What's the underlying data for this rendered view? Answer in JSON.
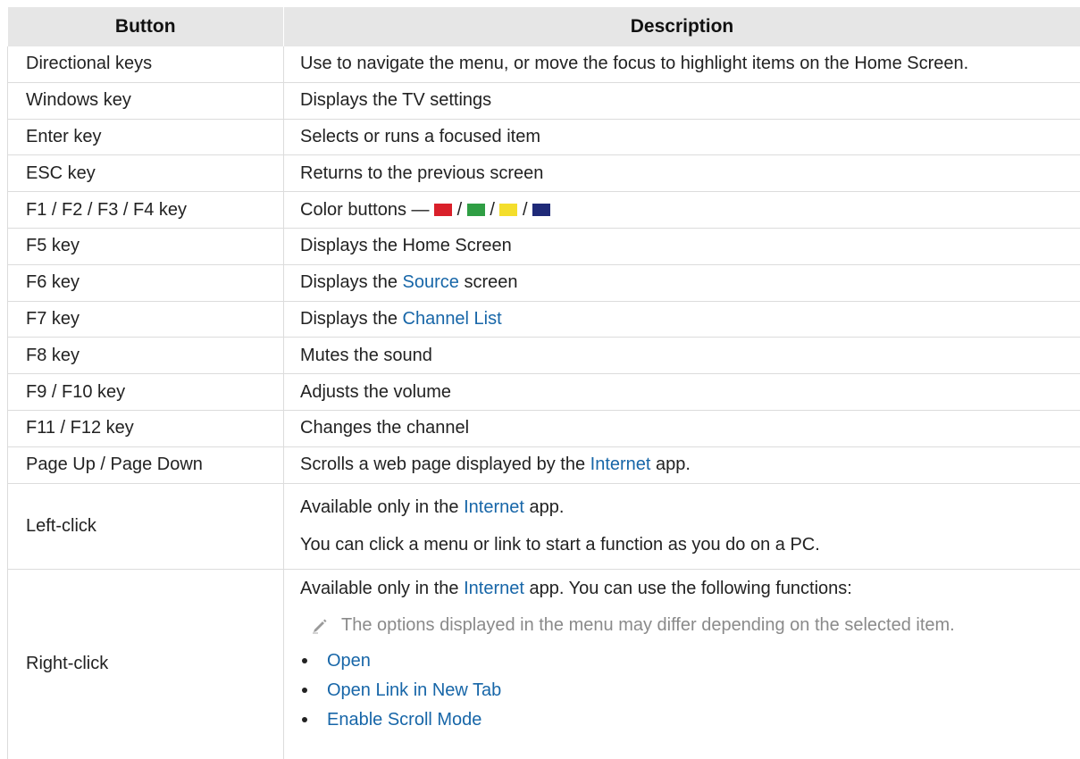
{
  "table": {
    "headers": [
      "Button",
      "Description"
    ],
    "rows": [
      {
        "button": "Directional keys",
        "description": "Use to navigate the menu, or move the focus to highlight items on the Home Screen."
      },
      {
        "button": "Windows key",
        "description": "Displays the TV settings"
      },
      {
        "button": "Enter key",
        "description": "Selects or runs a focused item"
      },
      {
        "button": "ESC key",
        "description": "Returns to the previous screen"
      },
      {
        "button": "F1 / F2 / F3 / F4 key",
        "description": "Color buttons —",
        "swatches": [
          "#d9202a",
          "#2f9e44",
          "#f4de2c",
          "#1f2a78"
        ],
        "separator": "/"
      },
      {
        "button": "F5 key",
        "description": "Displays the Home Screen"
      },
      {
        "button": "F6 key",
        "description_before": "Displays the",
        "description_link": "Source",
        "description_after": "screen"
      },
      {
        "button": "F7 key",
        "description_before": "Displays the",
        "description_link": "Channel List",
        "description_after": ""
      },
      {
        "button": "F8 key",
        "description": "Mutes the sound"
      },
      {
        "button": "F9 / F10 key",
        "description": "Adjusts the volume"
      },
      {
        "button": "F11 / F12 key",
        "description": "Changes the channel"
      },
      {
        "button": "Page Up / Page Down",
        "description_before": "Scrolls a web page displayed by the",
        "description_link": "Internet",
        "description_after": "app."
      },
      {
        "button": "Left-click",
        "line1_before": "Available only in the",
        "line1_link": "Internet",
        "line1_after": "app.",
        "line2": "You can click a menu or link to start a function as you do on a PC."
      },
      {
        "button": "Right-click",
        "line1_before": "Available only in the",
        "line1_link": "Internet",
        "line1_after": "app. You can use the following functions:",
        "note": "The options displayed in the menu may differ depending on the selected item.",
        "note_icon": "pencil-icon",
        "items": [
          "Open",
          "Open Link in New Tab",
          "Enable Scroll Mode"
        ]
      }
    ]
  },
  "colors": {
    "link": "#1766a8",
    "header_bg": "#e6e6e6"
  }
}
